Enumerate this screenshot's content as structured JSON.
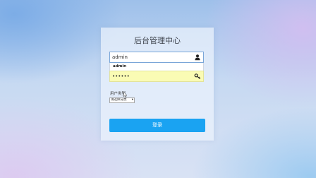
{
  "page": {
    "title": "后台管理中心"
  },
  "login_form": {
    "username_value": "admin",
    "password_value": "••••••",
    "autocomplete_suggestion": "admin",
    "user_type_label": "用户类型",
    "user_type_selected": "请选择分类",
    "submit_label": "登录"
  },
  "icons": {
    "username": "user-icon",
    "password": "key-icon",
    "dropdown": "chevron-down-icon"
  },
  "colors": {
    "button": "#1aa3f2",
    "password_autofill": "#fafbb4",
    "input_focus_border": "#7aa6d8"
  }
}
